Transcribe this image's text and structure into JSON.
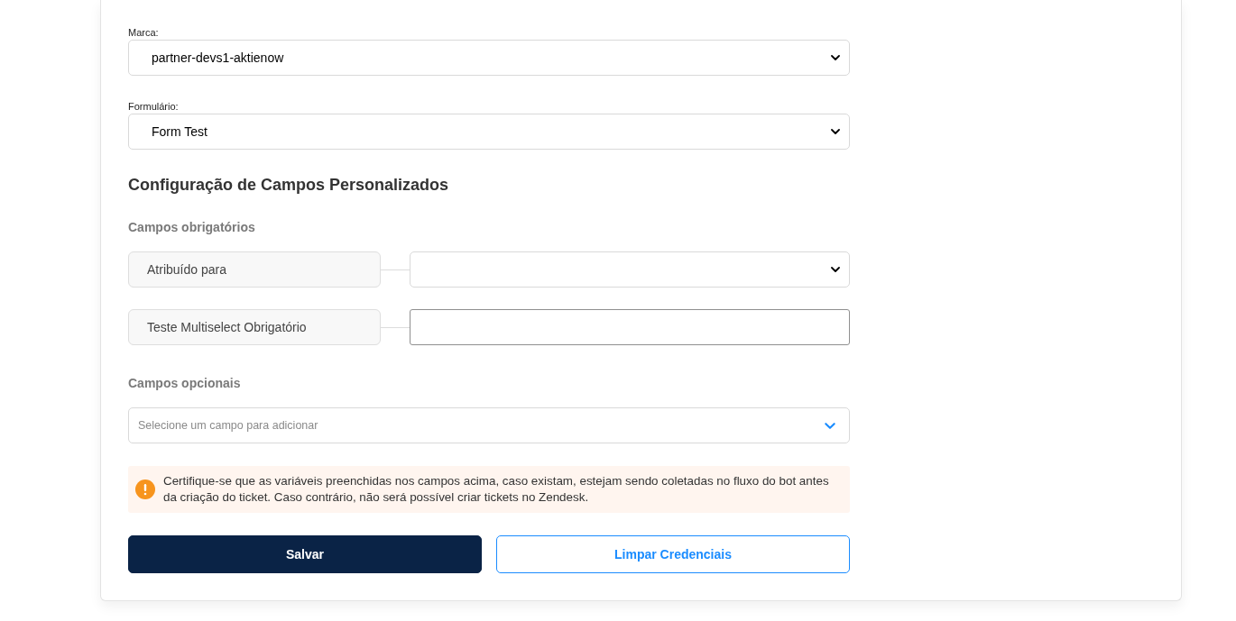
{
  "brand": {
    "label": "Marca:",
    "value": "partner-devs1-aktienow"
  },
  "form": {
    "label": "Formulário:",
    "value": "Form Test"
  },
  "section_title": "Configuração de Campos Personalizados",
  "required_fields": {
    "title": "Campos obrigatórios",
    "items": [
      {
        "label": "Atribuído para",
        "kind": "select"
      },
      {
        "label": "Teste Multiselect Obrigatório",
        "kind": "input"
      }
    ]
  },
  "optional_fields": {
    "title": "Campos opcionais",
    "placeholder": "Selecione um campo para adicionar"
  },
  "warning": "Certifique-se que as variáveis preenchidas nos campos acima, caso existam, estejam sendo coletadas no fluxo do bot antes da criação do ticket. Caso contrário, não será possível criar tickets no Zendesk.",
  "buttons": [
    {
      "label": "Salvar",
      "kind": "primary"
    },
    {
      "label": "Limpar Credenciais",
      "kind": "outline"
    }
  ]
}
